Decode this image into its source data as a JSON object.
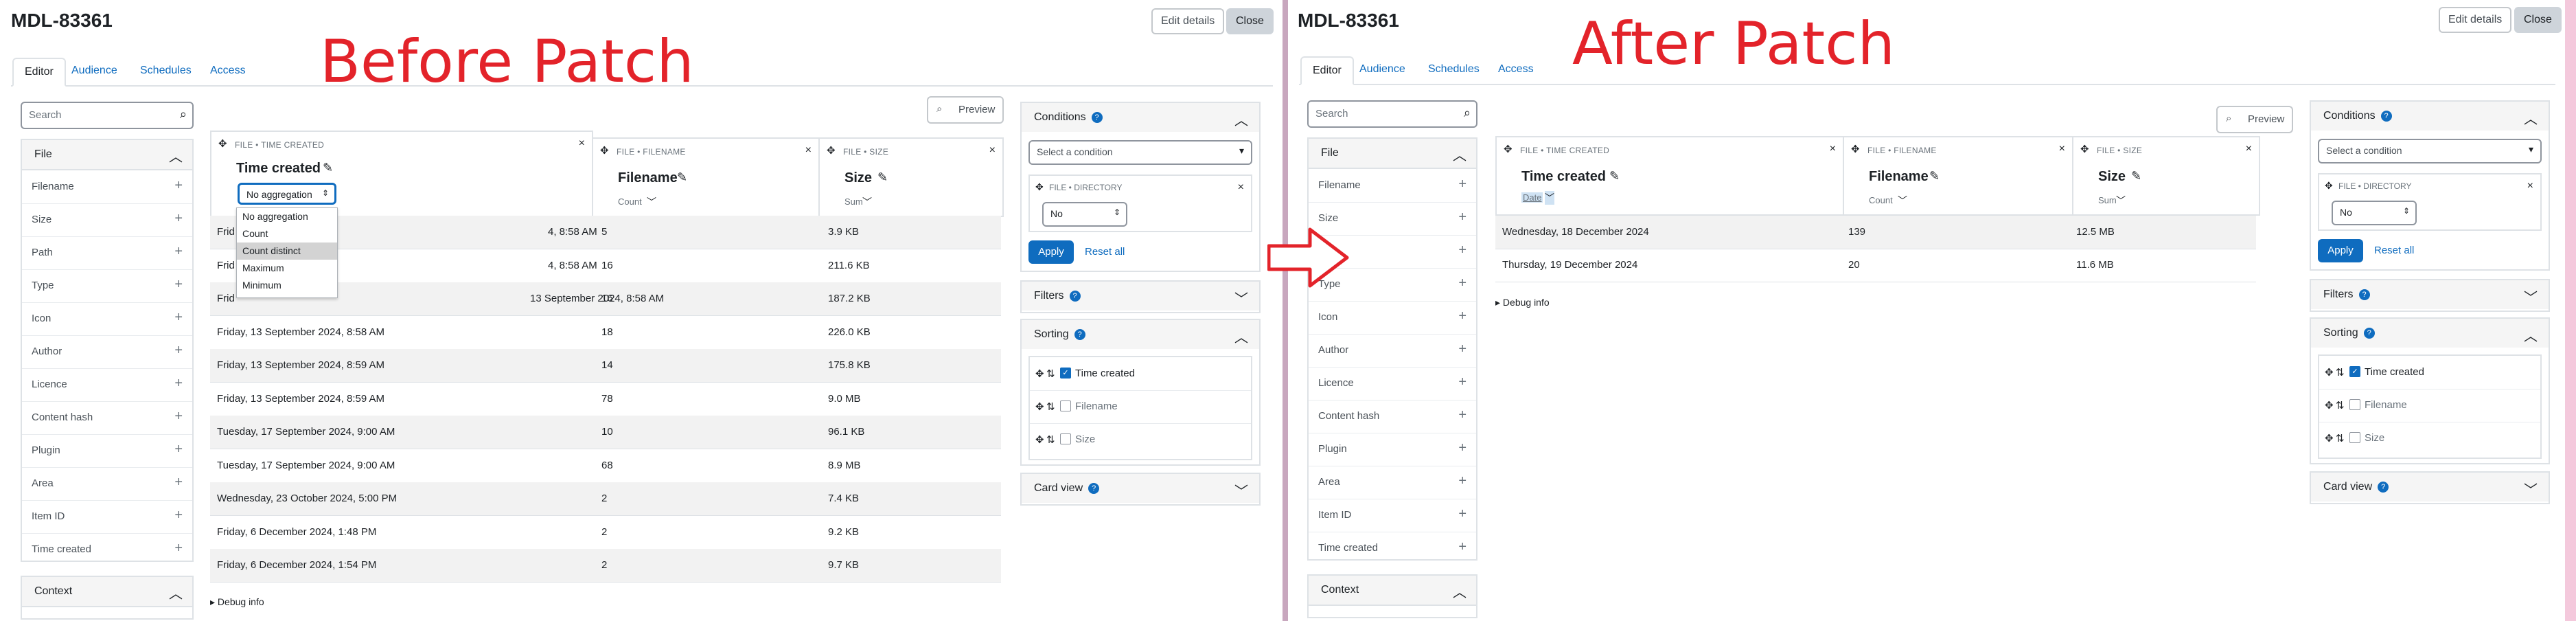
{
  "labels": {
    "before": "Before Patch",
    "after": "After Patch"
  },
  "common": {
    "title": "MDL-83361",
    "edit_details": "Edit details",
    "close": "Close",
    "tabs": [
      "Editor",
      "Audience",
      "Schedules",
      "Access"
    ],
    "search_placeholder": "Search",
    "preview": "Preview",
    "sidebar_head": "File",
    "sidebar_items": [
      "Filename",
      "Size",
      "Path",
      "Type",
      "Icon",
      "Author",
      "Licence",
      "Content hash",
      "Plugin",
      "Area",
      "Item ID",
      "Time created"
    ],
    "context_head": "Context",
    "columns": [
      {
        "meta": "FILE • TIME CREATED",
        "name": "Time created"
      },
      {
        "meta": "FILE • FILENAME",
        "name": "Filename",
        "agg": "Count"
      },
      {
        "meta": "FILE • SIZE",
        "name": "Size",
        "agg": "Sum"
      }
    ],
    "conditions_title": "Conditions",
    "select_condition": "Select a condition",
    "cond_meta": "FILE • DIRECTORY",
    "cond_value": "No",
    "apply": "Apply",
    "reset_all": "Reset all",
    "filters_title": "Filters",
    "sorting_title": "Sorting",
    "sort_items": [
      {
        "label": "Time created",
        "checked": true
      },
      {
        "label": "Filename",
        "checked": false
      },
      {
        "label": "Size",
        "checked": false
      }
    ],
    "card_view": "Card view",
    "debug_info": "Debug info"
  },
  "before": {
    "agg_select": "No aggregation",
    "dropdown": [
      "No aggregation",
      "Count",
      "Count distinct",
      "Maximum",
      "Minimum"
    ],
    "dropdown_highlight": "Count distinct",
    "rows": [
      [
        "Frid",
        "5",
        "3.9 KB"
      ],
      [
        "Frid",
        "16",
        "211.6 KB"
      ],
      [
        "Frid",
        "16",
        "187.2 KB"
      ],
      [
        "Friday, 13 September 2024, 8:58 AM",
        "18",
        "226.0 KB"
      ],
      [
        "Friday, 13 September 2024, 8:59 AM",
        "14",
        "175.8 KB"
      ],
      [
        "Friday, 13 September 2024, 8:59 AM",
        "78",
        "9.0 MB"
      ],
      [
        "Tuesday, 17 September 2024, 9:00 AM",
        "10",
        "96.1 KB"
      ],
      [
        "Tuesday, 17 September 2024, 9:00 AM",
        "68",
        "8.9 MB"
      ],
      [
        "Wednesday, 23 October 2024, 5:00 PM",
        "2",
        "7.4 KB"
      ],
      [
        "Friday, 6 December 2024, 1:48 PM",
        "2",
        "9.2 KB"
      ],
      [
        "Friday, 6 December 2024, 1:54 PM",
        "2",
        "9.7 KB"
      ]
    ],
    "row_overlay_parts": [
      "4, 8:58 AM",
      "4, 8:58 AM",
      "13 September 2024, 8:58 AM"
    ]
  },
  "after": {
    "date_agg": "Date",
    "rows": [
      [
        "Wednesday, 18 December 2024",
        "139",
        "12.5 MB"
      ],
      [
        "Thursday, 19 December 2024",
        "20",
        "11.6 MB"
      ]
    ]
  },
  "colors": {
    "accent": "#0f6cbf",
    "label_red": "#e3232a"
  }
}
